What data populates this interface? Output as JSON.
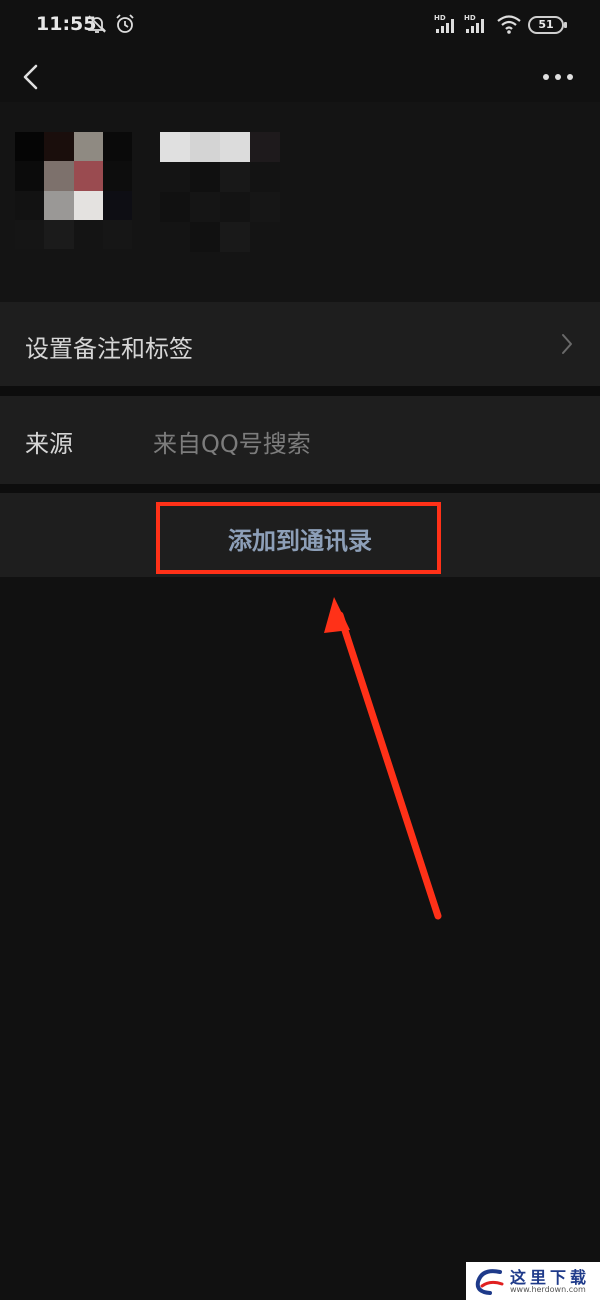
{
  "status_bar": {
    "time": "11:55",
    "battery": "51",
    "icons": [
      "mute-bell-icon",
      "alarm-icon",
      "signal-hd-icon",
      "signal-hd-icon",
      "wifi-icon",
      "battery-icon"
    ]
  },
  "nav": {
    "back_icon": "chevron-left-icon",
    "more_icon": "more-dots-icon"
  },
  "profile": {
    "avatar": "pixelated-avatar",
    "nickname": "pixelated-name"
  },
  "rows": {
    "remark_label": "设置备注和标签",
    "source_label": "来源",
    "source_value": "来自QQ号搜索",
    "add_contact_label": "添加到通讯录"
  },
  "annotations": {
    "highlight_color": "#ff3118",
    "arrow_color": "#ff3118"
  },
  "watermark": {
    "title": "这里下载",
    "url": "www.herdown.com"
  },
  "colors": {
    "background": "#111111",
    "row_background": "#1e1e1e",
    "add_contact_text": "#8d9fb8"
  }
}
